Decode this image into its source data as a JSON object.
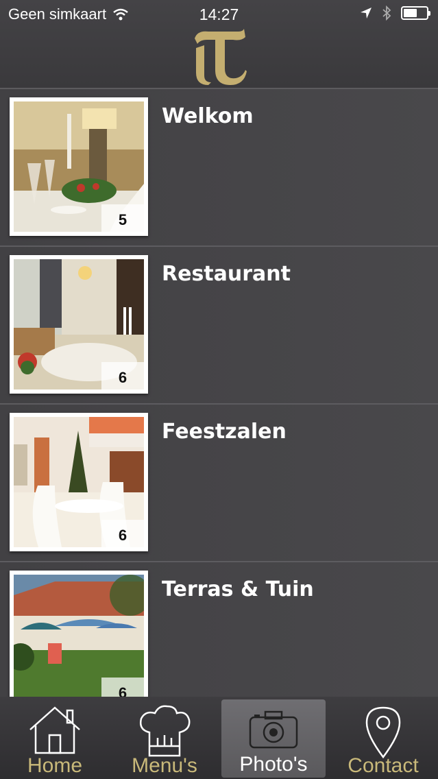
{
  "status_bar": {
    "carrier": "Geen simkaart",
    "time": "14:27",
    "battery_level": 0.6
  },
  "header": {
    "logo_letter": "T",
    "logo_color": "#c4ae70"
  },
  "items": [
    {
      "title": "Welkom",
      "count": "5"
    },
    {
      "title": "Restaurant",
      "count": "6"
    },
    {
      "title": "Feestzalen",
      "count": "6"
    },
    {
      "title": "Terras & Tuin",
      "count": "6"
    }
  ],
  "tabbar": {
    "tabs": [
      {
        "label": "Home",
        "icon": "house-icon"
      },
      {
        "label": "Menu's",
        "icon": "chef-hat-icon"
      },
      {
        "label": "Photo's",
        "icon": "camera-icon",
        "active": true
      },
      {
        "label": "Contact",
        "icon": "map-pin-icon"
      }
    ],
    "label_color": "#c9b97a"
  }
}
